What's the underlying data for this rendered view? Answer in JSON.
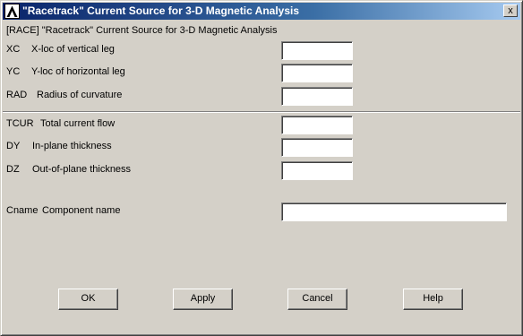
{
  "window": {
    "title": "\"Racetrack\" Current Source for 3-D Magnetic Analysis",
    "close_glyph": "x",
    "icon": "ansys-logo-icon"
  },
  "header": {
    "text": "[RACE]  \"Racetrack\" Current Source for 3-D Magnetic Analysis"
  },
  "fields": {
    "xc": {
      "code": "XC",
      "label": "X-loc of vertical leg",
      "value": ""
    },
    "yc": {
      "code": "YC",
      "label": "Y-loc of horizontal leg",
      "value": ""
    },
    "rad": {
      "code": "RAD",
      "label": "Radius of curvature",
      "value": ""
    },
    "tcur": {
      "code": "TCUR",
      "label": "Total current flow",
      "value": ""
    },
    "dy": {
      "code": "DY",
      "label": "In-plane thickness",
      "value": ""
    },
    "dz": {
      "code": "DZ",
      "label": "Out-of-plane thickness",
      "value": ""
    },
    "cname": {
      "code": "Cname",
      "label": "Component name",
      "value": ""
    }
  },
  "buttons": {
    "ok": "OK",
    "apply": "Apply",
    "cancel": "Cancel",
    "help": "Help"
  }
}
